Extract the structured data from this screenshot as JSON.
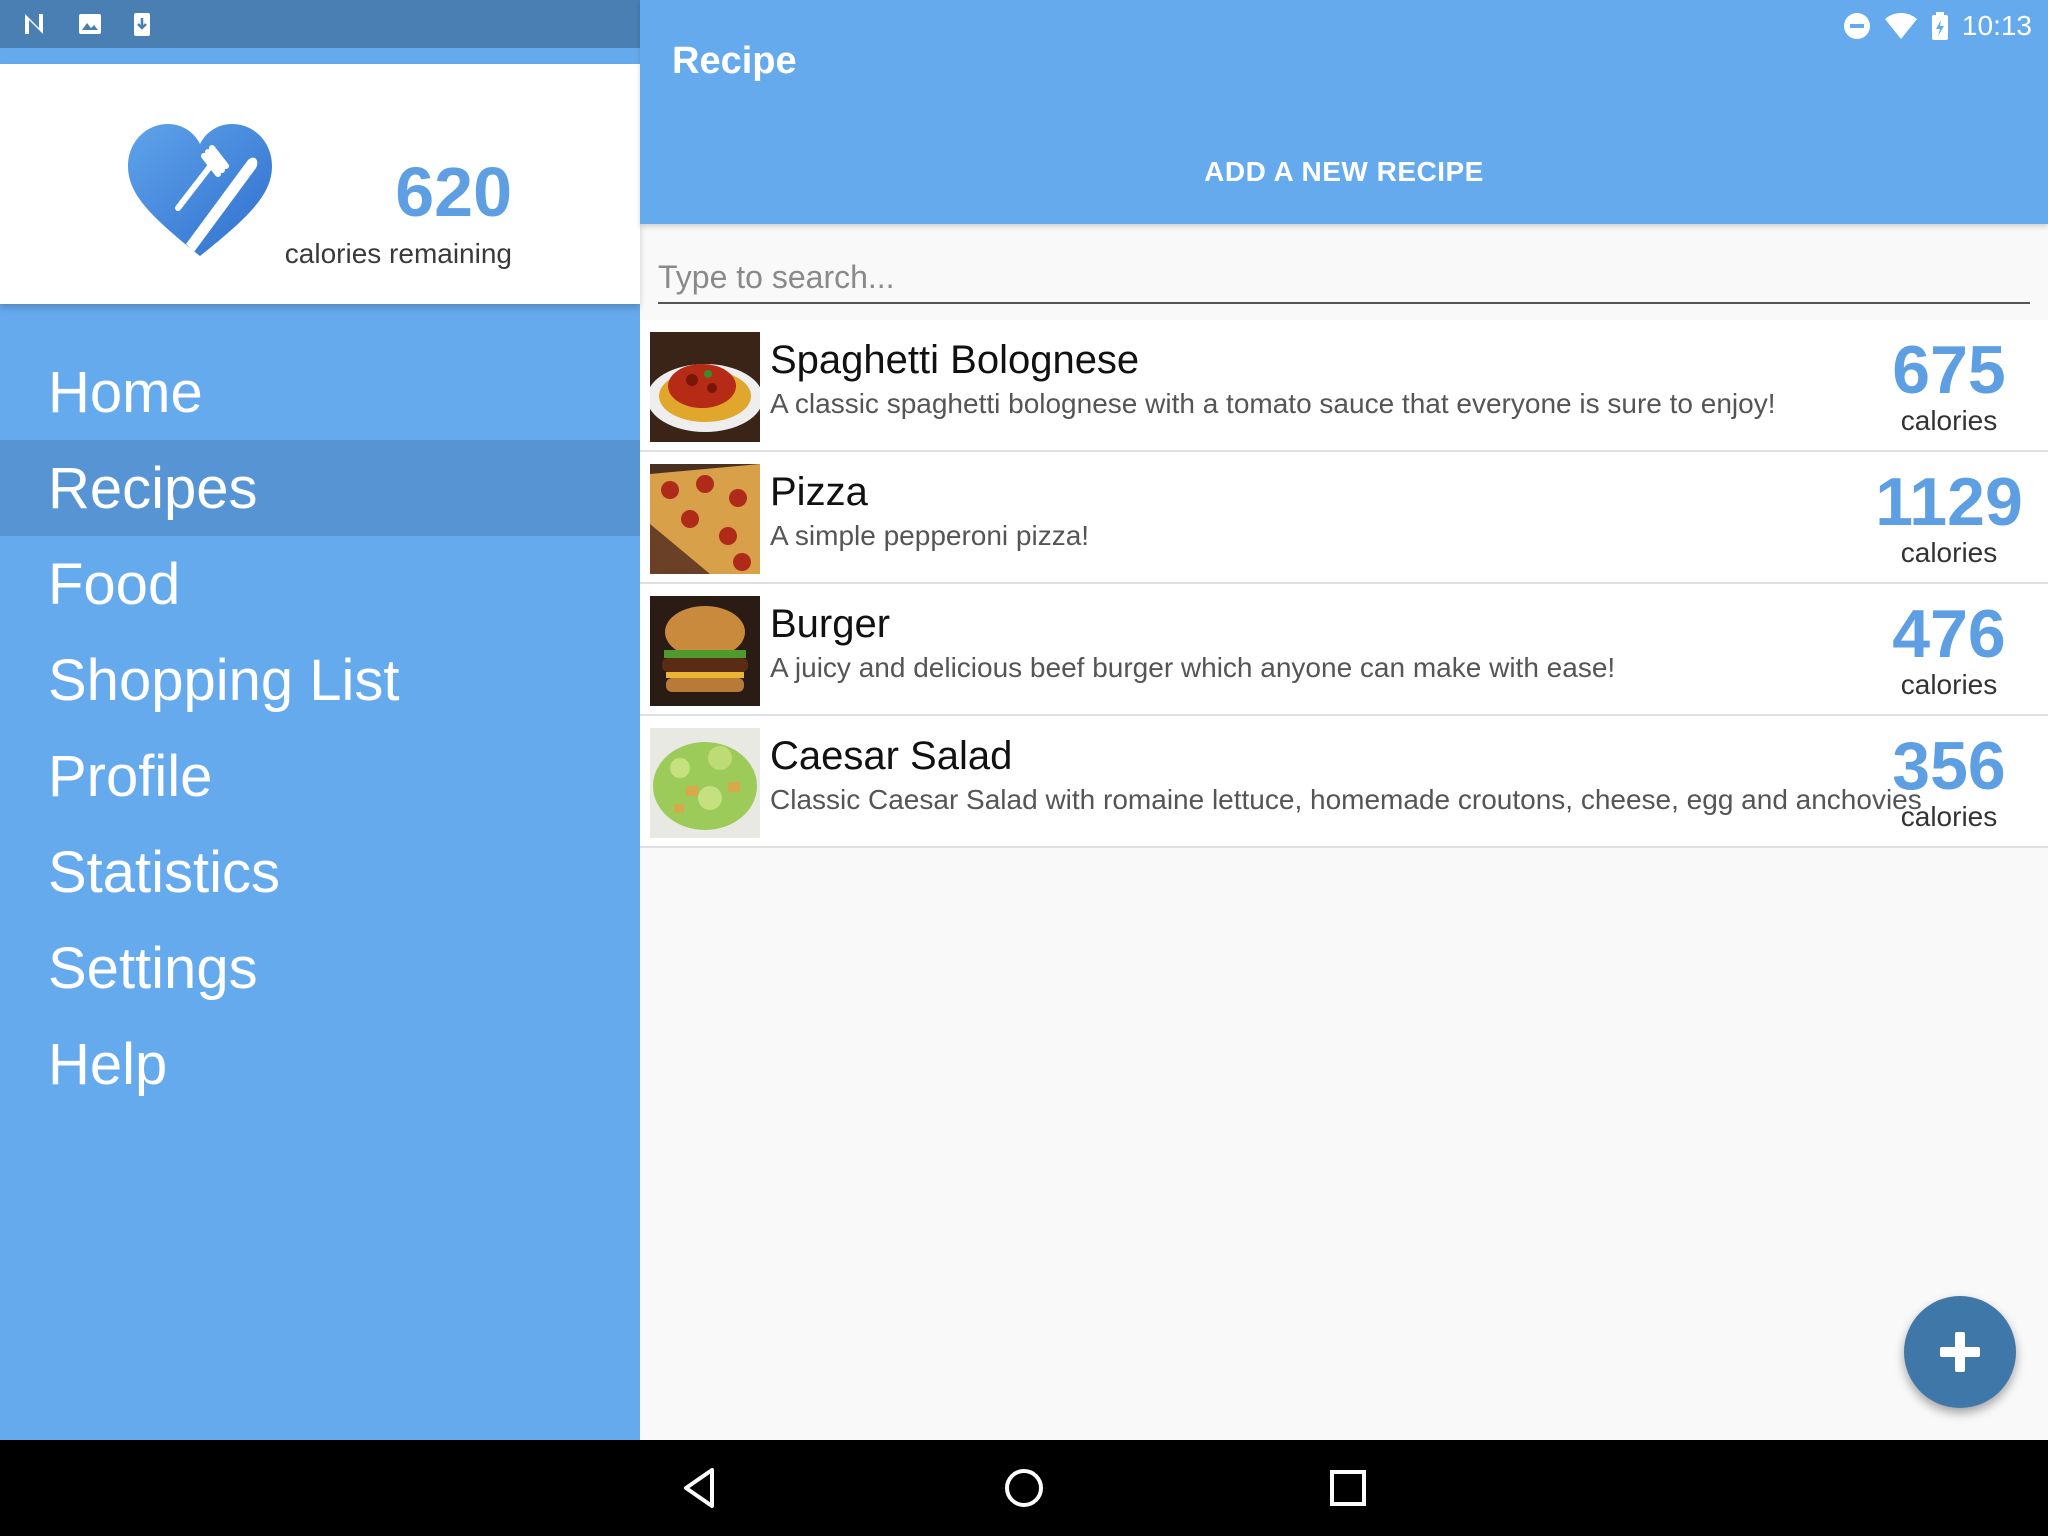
{
  "status": {
    "time": "10:13"
  },
  "drawer": {
    "calories_value": "620",
    "calories_label": "calories remaining",
    "items": [
      {
        "label": "Home"
      },
      {
        "label": "Recipes",
        "active": true
      },
      {
        "label": "Food"
      },
      {
        "label": "Shopping List"
      },
      {
        "label": "Profile"
      },
      {
        "label": "Statistics"
      },
      {
        "label": "Settings"
      },
      {
        "label": "Help"
      }
    ]
  },
  "toolbar": {
    "title": "Recipe",
    "add_label": "ADD A NEW RECIPE"
  },
  "search": {
    "placeholder": "Type to search..."
  },
  "recipes": [
    {
      "title": "Spaghetti Bolognese",
      "description": "A classic spaghetti bolognese with a tomato sauce that everyone is sure to enjoy!",
      "calories": "675",
      "unit": "calories",
      "image": "spaghetti-photo"
    },
    {
      "title": "Pizza",
      "description": "A simple pepperoni pizza!",
      "calories": "1129",
      "unit": "calories",
      "image": "pizza-photo"
    },
    {
      "title": "Burger",
      "description": "A juicy and delicious beef burger which anyone can make with ease!",
      "calories": "476",
      "unit": "calories",
      "image": "burger-photo"
    },
    {
      "title": "Caesar Salad",
      "description": "Classic Caesar Salad with romaine lettuce, homemade croutons, cheese, egg and anchovies",
      "calories": "356",
      "unit": "calories",
      "image": "salad-photo"
    }
  ],
  "colors": {
    "primary": "#66aaee",
    "status": "#4a7fb3",
    "accent": "#5d9fe2",
    "fab": "#3f77a8",
    "active_item": "#5794d4"
  }
}
